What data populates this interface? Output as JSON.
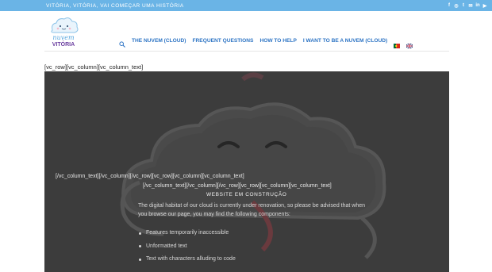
{
  "topbar": {
    "tagline": "Vitória, Vitória, vai começar uma história",
    "social_icons": [
      "facebook-icon",
      "instagram-icon",
      "twitter-icon",
      "email-icon",
      "linkedin-icon",
      "youtube-icon"
    ]
  },
  "logo": {
    "line1": "nuvem",
    "line2": "VITÓRIA"
  },
  "nav": {
    "items": [
      {
        "label": "THE NUVEM (CLOUD)"
      },
      {
        "label": "FREQUENT QUESTIONS"
      },
      {
        "label": "HOW TO HELP"
      },
      {
        "label": "I WANT TO BE A NUVEM (CLOUD)"
      }
    ],
    "languages": [
      "pt-flag-icon",
      "en-flag-icon"
    ]
  },
  "content": {
    "shortcode_top": "[vc_row][vc_column][vc_column_text]",
    "shortcode_mid1": "[/vc_column_text][/vc_column][/vc_row][vc_row][vc_column][vc_column_text]",
    "shortcode_mid2": "[/vc_column_text][/vc_column][/vc_row][vc_row][vc_column][vc_column_text]",
    "title": "WEBSITE EM CONSTRUÇÃO",
    "paragraph": "The digital habitat of our cloud is currently under renovation, so please be advised that when you browse our page, you may find the following components:",
    "bullets": [
      "Features temporarily inaccessible",
      "Unformatted text",
      "Text with characters alluding to code"
    ]
  },
  "colors": {
    "accent": "#6ab4e6",
    "nav_text": "#2d74c4",
    "hero_bg": "#3c3c3c"
  }
}
